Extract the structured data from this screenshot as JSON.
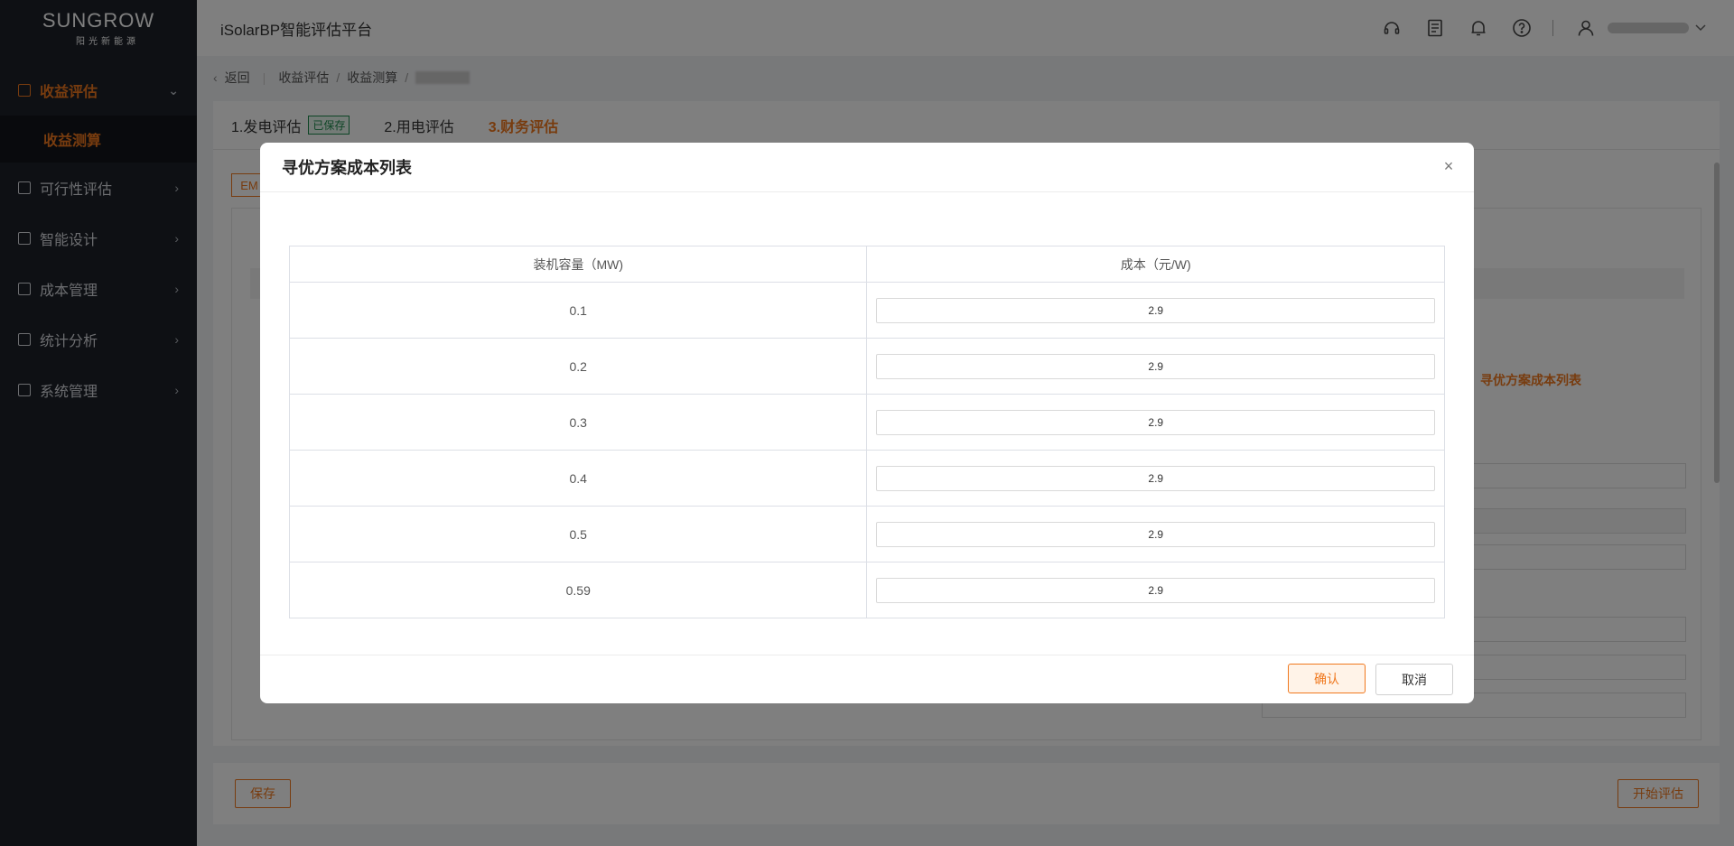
{
  "brand": {
    "name": "SUNGROW",
    "subtitle": "阳光新能源"
  },
  "header": {
    "app_title": "iSolarBP智能评估平台"
  },
  "sidebar": {
    "items": [
      {
        "label": "收益评估",
        "icon": "revenue-icon",
        "expanded": true
      },
      {
        "label": "可行性评估",
        "icon": "feasibility-icon"
      },
      {
        "label": "智能设计",
        "icon": "design-icon"
      },
      {
        "label": "成本管理",
        "icon": "cost-icon"
      },
      {
        "label": "统计分析",
        "icon": "stats-icon"
      },
      {
        "label": "系统管理",
        "icon": "system-icon"
      }
    ],
    "active_sub": "收益测算"
  },
  "breadcrumb": {
    "back": "返回",
    "level1": "收益评估",
    "level2": "收益测算"
  },
  "steps": [
    {
      "label": "1.发电评估",
      "badge": "已保存"
    },
    {
      "label": "2.用电评估"
    },
    {
      "label": "3.财务评估",
      "active": true
    }
  ],
  "background_fragments": {
    "tag": "EM",
    "link": "寻优方案成本列表"
  },
  "modal": {
    "title": "寻优方案成本列表",
    "columns": [
      "装机容量（MW)",
      "成本（元/W)"
    ],
    "rows": [
      {
        "capacity": "0.1",
        "cost": "2.9"
      },
      {
        "capacity": "0.2",
        "cost": "2.9"
      },
      {
        "capacity": "0.3",
        "cost": "2.9"
      },
      {
        "capacity": "0.4",
        "cost": "2.9"
      },
      {
        "capacity": "0.5",
        "cost": "2.9"
      },
      {
        "capacity": "0.59",
        "cost": "2.9"
      }
    ],
    "confirm": "确认",
    "cancel": "取消"
  },
  "bottom": {
    "save": "保存",
    "start": "开始评估"
  },
  "colors": {
    "accent": "#f0781e",
    "sidebar_bg": "#1c2028",
    "saved": "#1d8a4c"
  }
}
